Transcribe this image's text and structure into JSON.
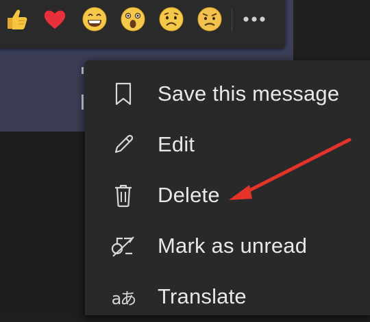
{
  "reactions": [
    {
      "name": "like",
      "icon": "thumbs-up-icon"
    },
    {
      "name": "heart",
      "icon": "heart-icon"
    },
    {
      "name": "laugh",
      "icon": "laughing-face-icon"
    },
    {
      "name": "surprised",
      "icon": "surprised-face-icon"
    },
    {
      "name": "sad",
      "icon": "sad-face-icon"
    },
    {
      "name": "angry",
      "icon": "angry-face-icon"
    }
  ],
  "more_options": {
    "icon": "more-dots-icon",
    "label": "•••"
  },
  "context_menu": {
    "items": [
      {
        "label": "Save this message",
        "icon": "bookmark-icon"
      },
      {
        "label": "Edit",
        "icon": "pencil-icon"
      },
      {
        "label": "Delete",
        "icon": "trash-icon"
      },
      {
        "label": "Mark as unread",
        "icon": "mark-unread-icon"
      },
      {
        "label": "Translate",
        "icon": "translate-icon",
        "glyph": "aあ"
      }
    ]
  },
  "colors": {
    "menu_bg": "#292929",
    "reaction_bar_bg": "#2a2a2a",
    "message_bg": "#3b3d54",
    "text": "#e8e8e8",
    "annotation_arrow": "#e5332a"
  }
}
